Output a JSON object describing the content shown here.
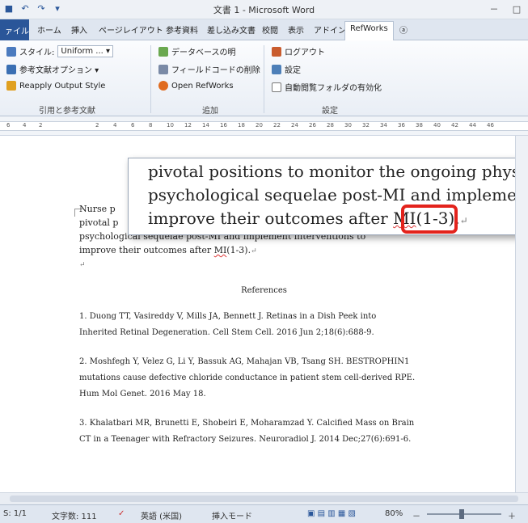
{
  "window": {
    "title": "文書 1 - Microsoft Word",
    "controls": [
      "－",
      "□"
    ]
  },
  "tabs": {
    "file": "ァイル",
    "items": [
      "ホーム",
      "挿入",
      "ページレイアウト",
      "参考資料",
      "差し込み文書",
      "校閲",
      "表示",
      "アドイン"
    ],
    "active": "RefWorks"
  },
  "ribbon": {
    "style_label": "スタイル:",
    "style_value": "Uniform ...",
    "bib_options": "参考文献オプション ▾",
    "reapply": "Reapply Output Style",
    "group1": "引用と参考文献",
    "db_clarify": "データベースの明",
    "field_code": "フィールドコードの削除",
    "open_refworks": "Open RefWorks",
    "group2": "追加",
    "logout": "ログアウト",
    "settings": "設定",
    "auto_folder": "自動閲覧フォルダの有効化",
    "group3": "設定"
  },
  "ruler": {
    "numbers": [
      "6",
      "4",
      "2",
      "2",
      "4",
      "6",
      "8",
      "10",
      "12",
      "14",
      "16",
      "18",
      "20",
      "22",
      "24",
      "26",
      "28",
      "30",
      "32",
      "34",
      "36",
      "38",
      "40",
      "42",
      "44",
      "46"
    ]
  },
  "document": {
    "para_line1": "Nurse p",
    "para_line2": "pivotal p",
    "para_line3": "psychological sequelae post-MI and implement interventions to",
    "para_line4_pre": "improve their outcomes after ",
    "para_line4_mi": "MI",
    "para_line4_post": "(1-3).",
    "return_mark": "↵",
    "blank_mark": "↵",
    "references_heading": "References",
    "refs": [
      {
        "line1": "1. Duong TT, Vasireddy V, Mills JA, Bennett J. Retinas in a Dish Peek into",
        "line2": "Inherited Retinal Degeneration. Cell Stem Cell. 2016 Jun 2;18(6):688-9."
      },
      {
        "line1": "2. Moshfegh Y, Velez G, Li Y, Bassuk AG, Mahajan VB, Tsang SH. BESTROPHIN1",
        "line2": "mutations cause defective chloride conductance in patient stem cell-derived RPE.",
        "line3": "Hum Mol Genet. 2016 May 18."
      },
      {
        "line1": "3. Khalatbari MR, Brunetti E, Shobeiri E, Moharamzad Y. Calcified Mass on Brain",
        "line2": "CT in a Teenager with Refractory Seizures. Neuroradiol J. 2014 Dec;27(6):691-6."
      }
    ]
  },
  "zoom": {
    "line1": "pivotal positions to monitor the ongoing physic",
    "line2": "psychological sequelae post-MI and implemen",
    "line3_pre": "improve their outcomes after ",
    "line3_mi": "MI",
    "line3_cite": "(1-3).",
    "line3_mark": "↵"
  },
  "status": {
    "page": "S: 1/1",
    "words": "文字数: 111",
    "lang": "英語 (米国)",
    "mode": "挿入モード",
    "zoom": "80%",
    "zoom_minus": "－",
    "zoom_plus": "＋"
  },
  "colors": {
    "highlight_box": "#e3231c",
    "file_tab": "#2a5699"
  }
}
